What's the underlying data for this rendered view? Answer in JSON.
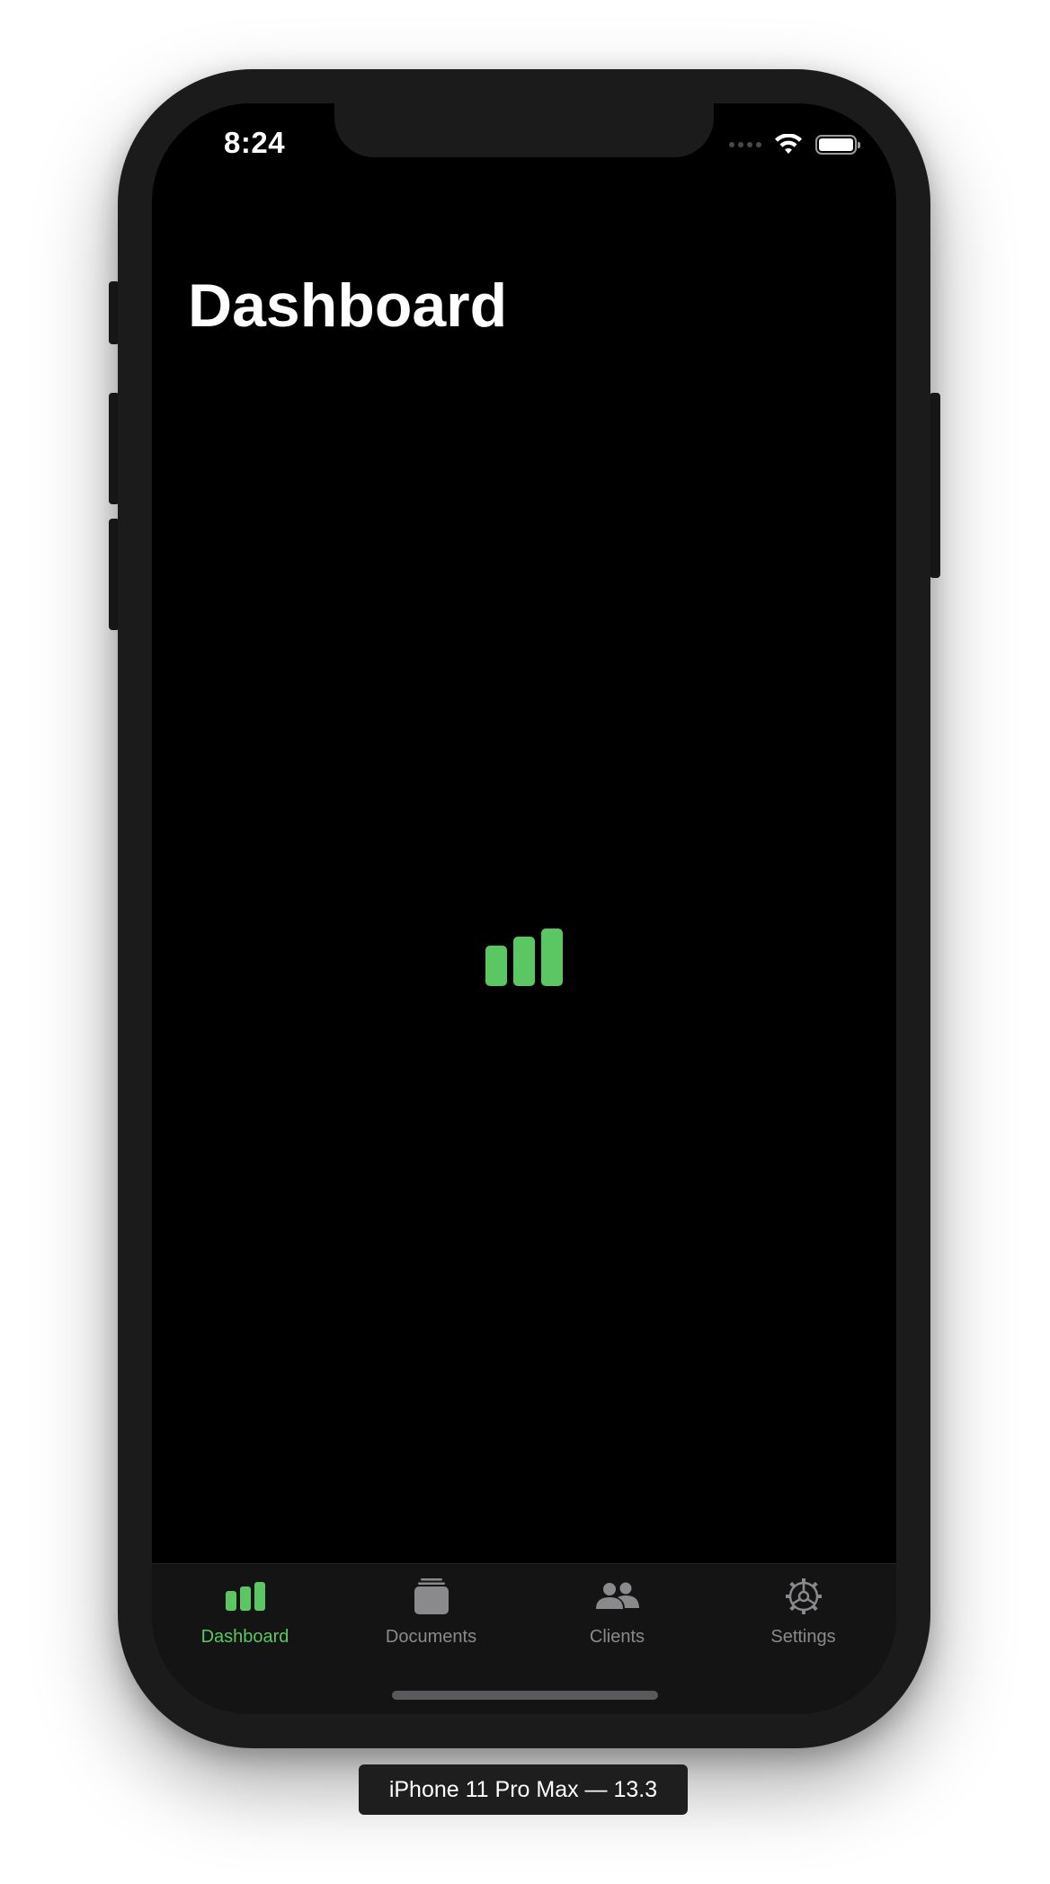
{
  "status_bar": {
    "time": "8:24"
  },
  "page": {
    "title": "Dashboard"
  },
  "center_icon": "bar-chart-icon",
  "accent_color": "#5ac763",
  "tabs": [
    {
      "label": "Dashboard",
      "icon": "bar-chart-icon",
      "active": true
    },
    {
      "label": "Documents",
      "icon": "documents-icon",
      "active": false
    },
    {
      "label": "Clients",
      "icon": "people-icon",
      "active": false
    },
    {
      "label": "Settings",
      "icon": "gear-icon",
      "active": false
    }
  ],
  "device_caption": "iPhone 11 Pro Max — 13.3"
}
